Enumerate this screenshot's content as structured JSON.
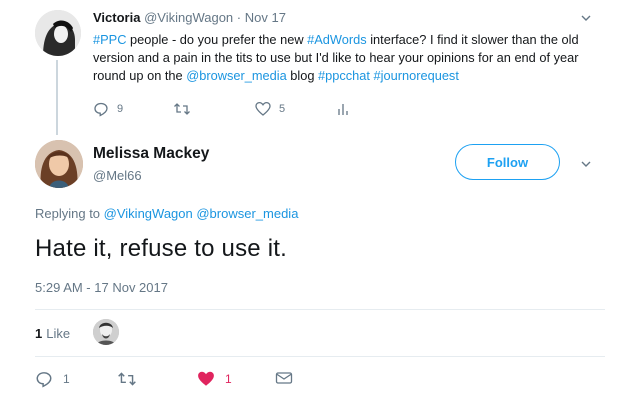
{
  "parent_tweet": {
    "name": "Victoria",
    "handle": "@VikingWagon",
    "separator": "·",
    "date": "Nov 17",
    "text_parts": {
      "t1": "#PPC",
      "t2": " people - do you prefer the new ",
      "t3": "#AdWords",
      "t4": " interface? I find it slower than the old version and a pain in the tits to use but I'd like to hear your opinions for an end of year round up on the ",
      "t5": "@browser_media",
      "t6": " blog ",
      "t7": "#ppcchat",
      "t8": " ",
      "t9": "#journorequest"
    },
    "reply_count": "9",
    "like_count": "5"
  },
  "main_tweet": {
    "name": "Melissa Mackey",
    "handle": "@Mel66",
    "follow_label": "Follow",
    "replying_prefix": "Replying to ",
    "replying_to_1": "@VikingWagon",
    "replying_to_2": "@browser_media",
    "text": "Hate it, refuse to use it.",
    "timestamp": "5:29 AM - 17 Nov 2017",
    "likes_count": "1",
    "likes_label": "Like",
    "reply_count": "1",
    "like_count": "1"
  },
  "colors": {
    "link": "#1b95e0",
    "follow": "#1da1f2",
    "liked": "#e0245e",
    "muted": "#657786"
  },
  "icons": {
    "reply": "reply-icon",
    "retweet": "retweet-icon",
    "like": "heart-icon",
    "analytics": "analytics-icon",
    "dm": "envelope-icon",
    "more": "chevron-down-icon"
  }
}
